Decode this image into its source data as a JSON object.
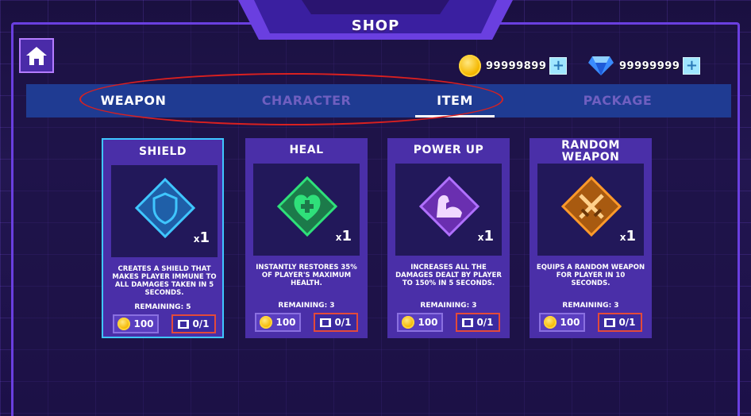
{
  "shop": {
    "title": "SHOP",
    "home_icon": "home-icon",
    "currency": {
      "coins": "99999899",
      "gems": "99999999",
      "plus_symbol": "+"
    },
    "tabs": [
      {
        "label": "WEAPON",
        "state": "normal"
      },
      {
        "label": "CHARACTER",
        "state": "disabled"
      },
      {
        "label": "ITEM",
        "state": "active"
      },
      {
        "label": "PACKAGE",
        "state": "disabled"
      }
    ],
    "items": [
      {
        "title": "SHIELD",
        "icon": "shield-icon",
        "icon_color": "#3fc6ff",
        "qty_prefix": "x",
        "qty": "1",
        "description": "CREATES A SHIELD THAT MAKES PLAYER IMMUNE TO ALL DAMAGES TAKEN IN 5 SECONDS.",
        "remaining": "REMAINING: 5",
        "price": "100",
        "ad_count": "0/1",
        "selected": true
      },
      {
        "title": "HEAL",
        "icon": "heart-plus-icon",
        "icon_color": "#2fe07a",
        "qty_prefix": "x",
        "qty": "1",
        "description": "INSTANTLY RESTORES 35% OF PLAYER'S MAXIMUM HEALTH.",
        "remaining": "REMAINING: 3",
        "price": "100",
        "ad_count": "0/1",
        "selected": false
      },
      {
        "title": "POWER UP",
        "icon": "muscle-icon",
        "icon_color": "#b070ff",
        "qty_prefix": "x",
        "qty": "1",
        "description": "INCREASES ALL THE DAMAGES DEALT BY PLAYER TO 150% IN 5 SECONDS.",
        "remaining": "REMAINING: 3",
        "price": "100",
        "ad_count": "0/1",
        "selected": false
      },
      {
        "title": "RANDOM WEAPON",
        "icon": "crossed-swords-icon",
        "icon_color": "#ff9a2a",
        "qty_prefix": "x",
        "qty": "1",
        "description": "EQUIPS A RANDOM WEAPON FOR PLAYER IN 10 SECONDS.",
        "remaining": "REMAINING: 3",
        "price": "100",
        "ad_count": "0/1",
        "selected": false
      }
    ]
  }
}
